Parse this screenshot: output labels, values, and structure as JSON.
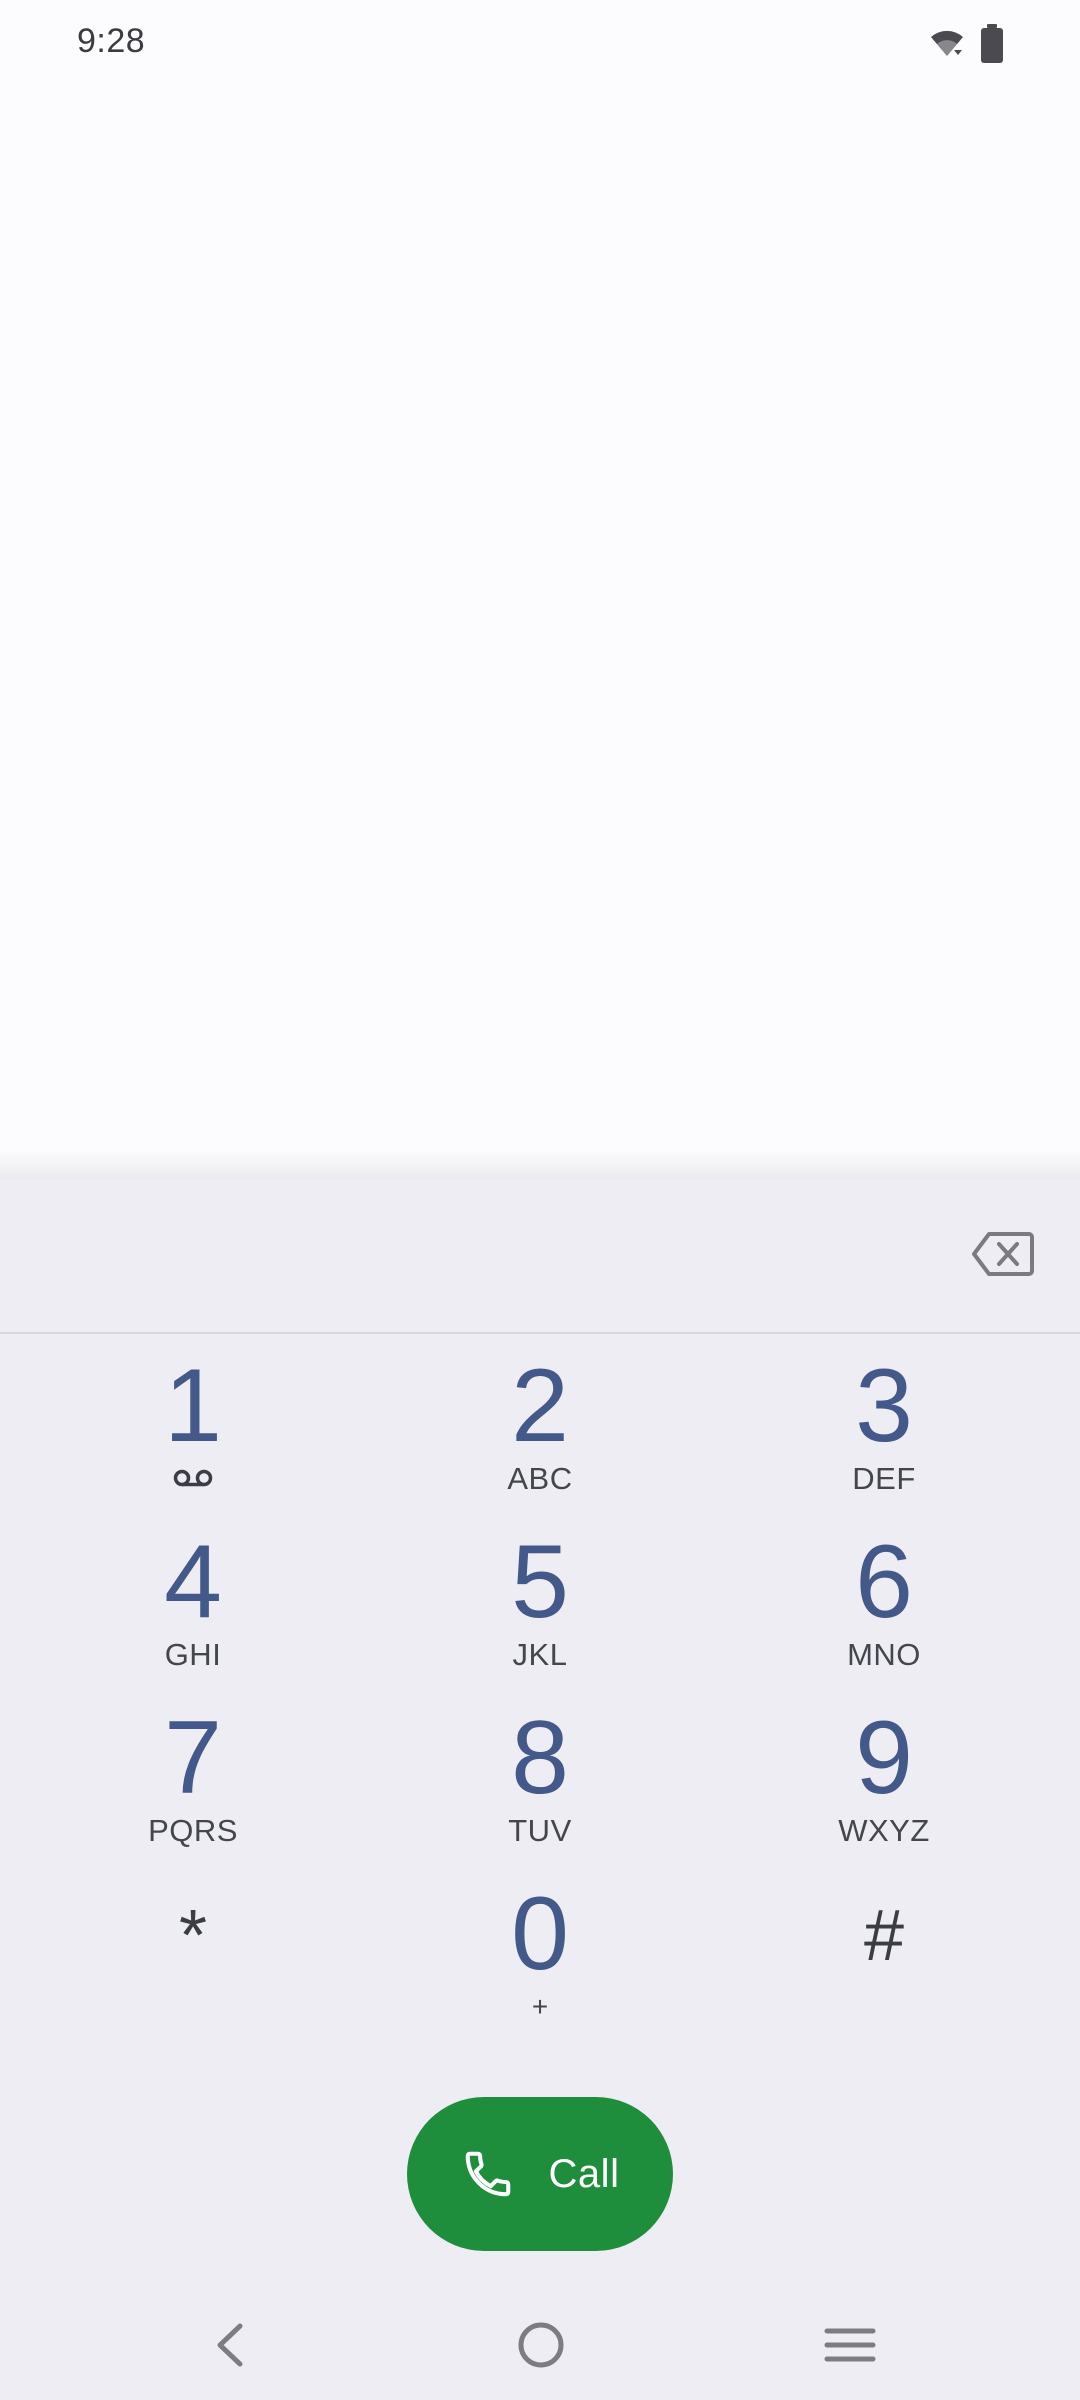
{
  "status_bar": {
    "time": "9:28",
    "icons": [
      "wifi-icon",
      "battery-icon"
    ]
  },
  "dialpad": {
    "input_value": "",
    "backspace_icon": "backspace-icon",
    "keys": [
      {
        "digit": "1",
        "letters": "",
        "icon": "voicemail-icon"
      },
      {
        "digit": "2",
        "letters": "ABC"
      },
      {
        "digit": "3",
        "letters": "DEF"
      },
      {
        "digit": "4",
        "letters": "GHI"
      },
      {
        "digit": "5",
        "letters": "JKL"
      },
      {
        "digit": "6",
        "letters": "MNO"
      },
      {
        "digit": "7",
        "letters": "PQRS"
      },
      {
        "digit": "8",
        "letters": "TUV"
      },
      {
        "digit": "9",
        "letters": "WXYZ"
      },
      {
        "digit": "*",
        "letters": ""
      },
      {
        "digit": "0",
        "letters": "+"
      },
      {
        "digit": "#",
        "letters": ""
      }
    ]
  },
  "call_button": {
    "label": "Call",
    "icon": "phone-icon",
    "color": "#1f8e3c"
  },
  "nav_bar": {
    "icons": [
      "back-icon",
      "home-icon",
      "menu-icon"
    ]
  },
  "colors": {
    "digit": "#43598a",
    "panel_bg": "#efedf4",
    "screen_bg": "#fcfbfd"
  }
}
